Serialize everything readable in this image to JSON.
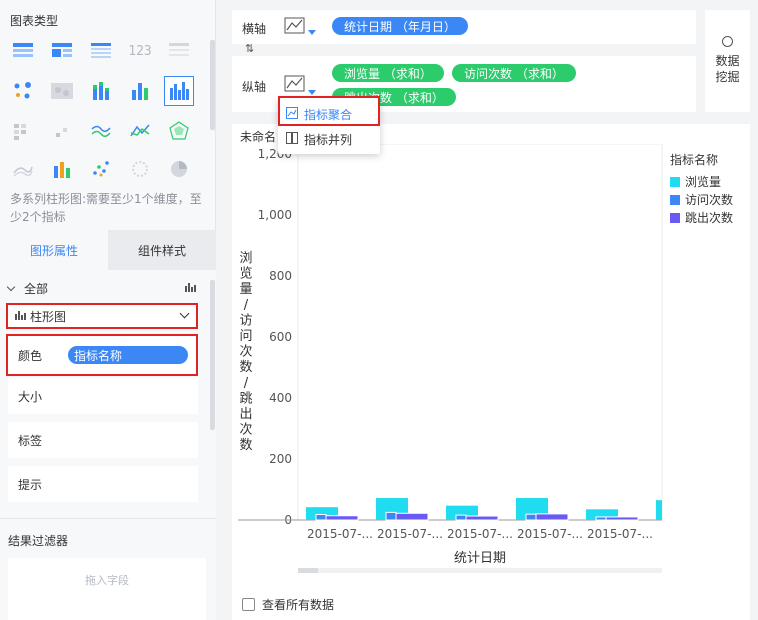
{
  "left": {
    "chart_types_title": "图表类型",
    "tip": "多系列柱形图:需要至少1个维度，至少2个指标",
    "tabs": [
      "图形属性",
      "组件样式"
    ],
    "all_label": "全部",
    "chart_select": "柱形图",
    "color_label": "颜色",
    "color_field": "指标名称",
    "size_label": "大小",
    "label_label": "标签",
    "hint_label": "提示",
    "filter_title": "结果过滤器",
    "drop_placeholder": "拖入字段",
    "thumb_icons": [
      "cross-table-icon",
      "group-table-icon",
      "detail-table-icon",
      "kpi-123-icon",
      "gray-table-icon",
      "dot-map-icon",
      "heat-map-icon",
      "stacked-bar-icon",
      "column-icon",
      "multi-column-icon",
      "grid-heat-icon",
      "scatter-small-icon",
      "area-wave-icon",
      "line-icon",
      "radar-icon",
      "area-line-icon",
      "combo-column-icon",
      "scatter-icon",
      "bubble-icon",
      "pie-icon"
    ]
  },
  "right": {
    "horizontal_axis_label": "横轴",
    "horizontal_field": "统计日期 （年月日）",
    "vertical_axis_label": "纵轴",
    "vertical_fields": [
      "浏览量 （求和）",
      "访问次数 （求和）",
      "跳出次数 （求和）"
    ],
    "data_mining_label": "数据\n挖掘",
    "dropdown_items": [
      "指标聚合",
      "指标并列"
    ],
    "chart_title_partial": "未命名",
    "view_all_label": "查看所有数据"
  },
  "chart_data": {
    "type": "bar",
    "ylabel": "浏览量/访问次数/跳出次数",
    "xlabel": "统计日期",
    "yticks": [
      "0",
      "200",
      "400",
      "600",
      "800",
      "1,000",
      "1,200"
    ],
    "ylim": [
      0,
      1200
    ],
    "categories": [
      "2015-07-...",
      "2015-07-...",
      "2015-07-...",
      "2015-07-...",
      "2015-07-...",
      "20"
    ],
    "legend_title": "指标名称",
    "series": [
      {
        "name": "浏览量",
        "color": "#1fdcf0",
        "values": [
          42,
          72,
          47,
          72,
          35,
          65
        ]
      },
      {
        "name": "访问次数",
        "color": "#3a87f5",
        "values": [
          18,
          25,
          16,
          19,
          10,
          20
        ]
      },
      {
        "name": "跳出次数",
        "color": "#6a5af5",
        "values": [
          14,
          22,
          13,
          20,
          10,
          18
        ]
      }
    ]
  }
}
